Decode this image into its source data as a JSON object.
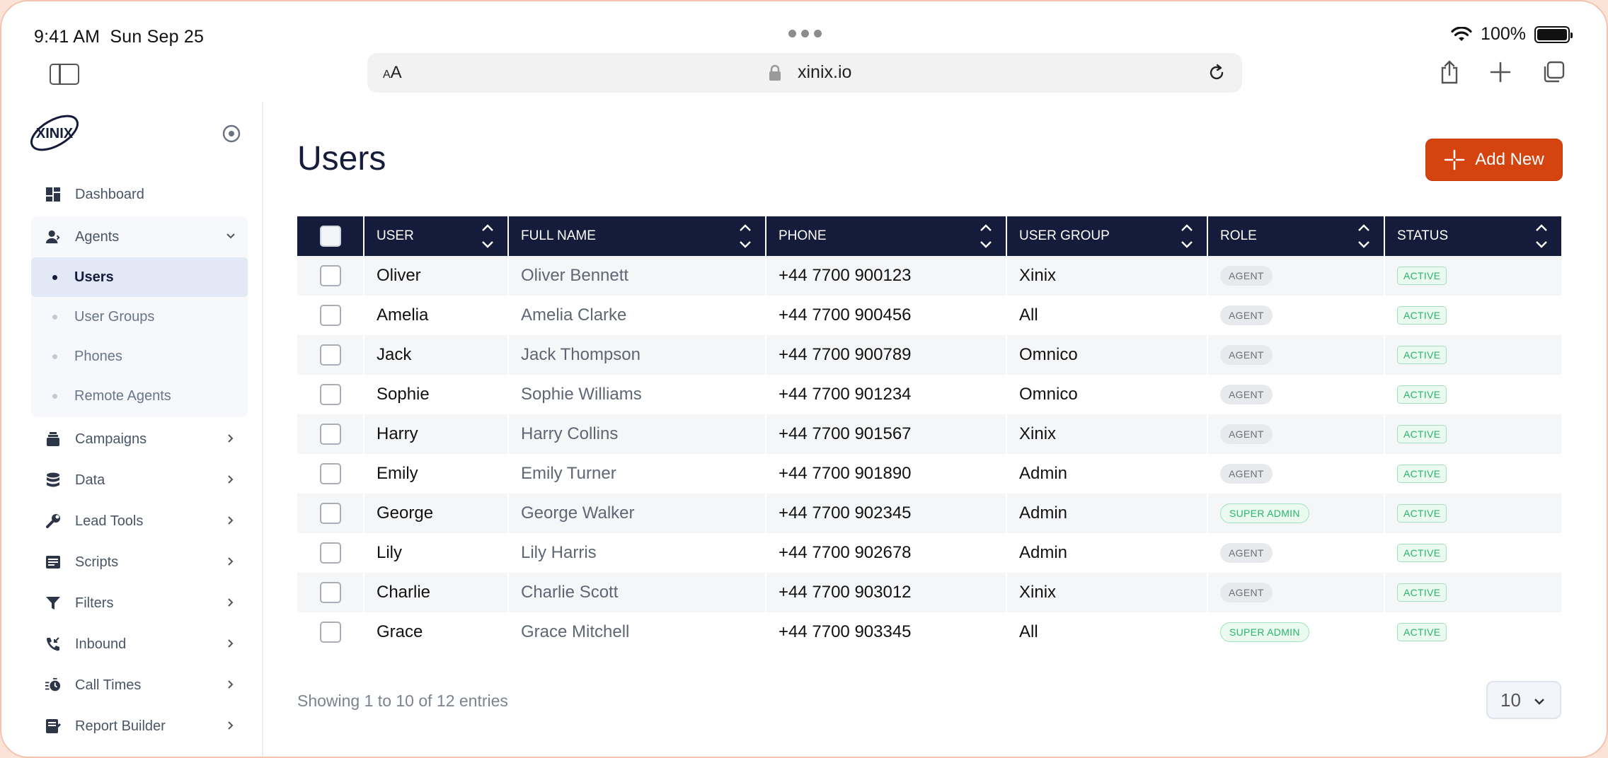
{
  "status_bar": {
    "time": "9:41 AM",
    "date": "Sun Sep 25",
    "battery": "100%"
  },
  "browser": {
    "text_size_label": "AA",
    "url": "xinix.io"
  },
  "sidebar": {
    "logo_text": "XINIX",
    "items": [
      {
        "label": "Dashboard",
        "icon": "dashboard-icon"
      },
      {
        "label": "Agents",
        "icon": "agents-icon",
        "expanded": true,
        "children": [
          {
            "label": "Users",
            "active": true
          },
          {
            "label": "User Groups"
          },
          {
            "label": "Phones"
          },
          {
            "label": "Remote Agents"
          }
        ]
      },
      {
        "label": "Campaigns",
        "icon": "campaigns-icon"
      },
      {
        "label": "Data",
        "icon": "database-icon"
      },
      {
        "label": "Lead Tools",
        "icon": "wrench-icon"
      },
      {
        "label": "Scripts",
        "icon": "scripts-icon"
      },
      {
        "label": "Filters",
        "icon": "filter-icon"
      },
      {
        "label": "Inbound",
        "icon": "phone-in-icon"
      },
      {
        "label": "Call Times",
        "icon": "timer-icon"
      },
      {
        "label": "Report Builder",
        "icon": "report-icon"
      }
    ]
  },
  "main": {
    "title": "Users",
    "add_button": "Add New",
    "columns": [
      "USER",
      "FULL NAME",
      "PHONE",
      "USER GROUP",
      "ROLE",
      "STATUS"
    ],
    "rows": [
      {
        "user": "Oliver",
        "full_name": "Oliver Bennett",
        "phone": "+44 7700 900123",
        "group": "Xinix",
        "role": "AGENT",
        "status": "ACTIVE"
      },
      {
        "user": "Amelia",
        "full_name": "Amelia Clarke",
        "phone": "+44 7700 900456",
        "group": "All",
        "role": "AGENT",
        "status": "ACTIVE"
      },
      {
        "user": "Jack",
        "full_name": "Jack Thompson",
        "phone": "+44 7700 900789",
        "group": "Omnico",
        "role": "AGENT",
        "status": "ACTIVE"
      },
      {
        "user": "Sophie",
        "full_name": "Sophie Williams",
        "phone": "+44 7700 901234",
        "group": "Omnico",
        "role": "AGENT",
        "status": "ACTIVE"
      },
      {
        "user": "Harry",
        "full_name": "Harry Collins",
        "phone": "+44 7700 901567",
        "group": "Xinix",
        "role": "AGENT",
        "status": "ACTIVE"
      },
      {
        "user": "Emily",
        "full_name": "Emily Turner",
        "phone": "+44 7700 901890",
        "group": "Admin",
        "role": "AGENT",
        "status": "ACTIVE"
      },
      {
        "user": "George",
        "full_name": "George Walker",
        "phone": "+44 7700 902345",
        "group": "Admin",
        "role": "SUPER ADMIN",
        "status": "ACTIVE"
      },
      {
        "user": "Lily",
        "full_name": "Lily Harris",
        "phone": "+44 7700 902678",
        "group": "Admin",
        "role": "AGENT",
        "status": "ACTIVE"
      },
      {
        "user": "Charlie",
        "full_name": "Charlie Scott",
        "phone": "+44 7700 903012",
        "group": "Xinix",
        "role": "AGENT",
        "status": "ACTIVE"
      },
      {
        "user": "Grace",
        "full_name": "Grace Mitchell",
        "phone": "+44 7700 903345",
        "group": "All",
        "role": "SUPER ADMIN",
        "status": "ACTIVE"
      }
    ],
    "footer": {
      "entries_text": "Showing 1 to 10 of 12 entries",
      "page_size": "10"
    }
  },
  "colors": {
    "accent": "#d5440f",
    "header_bg": "#141b3b",
    "active_green": "#2bb56a"
  }
}
